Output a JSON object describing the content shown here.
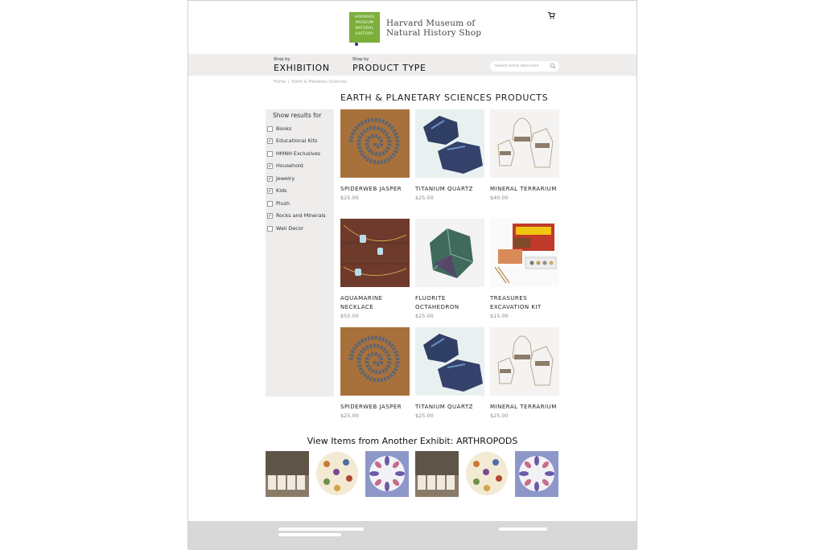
{
  "header": {
    "logo_text": "HARVARD MUSEUM NATURAL HISTORY",
    "brand_line1": "Harvard Museum of",
    "brand_line2": "Natural History Shop",
    "cart_icon": "cart-icon"
  },
  "nav": {
    "exhibition_small": "Shop by",
    "exhibition_label": "EXHIBITION",
    "product_small": "Shop by",
    "product_label": "PRODUCT TYPE",
    "search_placeholder": "Search entire store here"
  },
  "breadcrumb": {
    "home": "Home",
    "sep": "/",
    "current": "Earth & Planetary Sciences"
  },
  "page_title": "EARTH & PLANETARY SCIENCES PRODUCTS",
  "sidebar": {
    "title": "Show results for",
    "items": [
      {
        "label": "Books",
        "checked": false
      },
      {
        "label": "Educational Kits",
        "checked": true
      },
      {
        "label": "HMNH Exclusives",
        "checked": false
      },
      {
        "label": "Household",
        "checked": true
      },
      {
        "label": "Jewelry",
        "checked": true
      },
      {
        "label": "Kids",
        "checked": true
      },
      {
        "label": "Plush",
        "checked": false
      },
      {
        "label": "Rocks and Minerals",
        "checked": true
      },
      {
        "label": "Wall Decor",
        "checked": false
      }
    ]
  },
  "products": [
    {
      "name": "SPIDERWEB JASPER",
      "price": "$25.00"
    },
    {
      "name": "TITANIUM QUARTZ",
      "price": "$25.00"
    },
    {
      "name": "MINERAL TERRARIUM",
      "price": "$40.00"
    },
    {
      "name": "AQUAMARINE NECKLACE",
      "price": "$55.00"
    },
    {
      "name": "FLUORITE OCTAHEDRON",
      "price": "$25.00"
    },
    {
      "name": "TREASURES EXCAVATION KIT",
      "price": "$15.00"
    },
    {
      "name": "SPIDERWEB JASPER",
      "price": "$25.00"
    },
    {
      "name": "TITANIUM QUARTZ",
      "price": "$25.00"
    },
    {
      "name": "MINERAL TERRARIUM",
      "price": "$25.00"
    }
  ],
  "other_exhibit": {
    "title": "View Items from Another Exhibit: ARTHROPODS"
  },
  "colors": {
    "logo_green": "#7cae3a",
    "nav_bg": "#efecec",
    "footer_bg": "#d8d8d8"
  }
}
